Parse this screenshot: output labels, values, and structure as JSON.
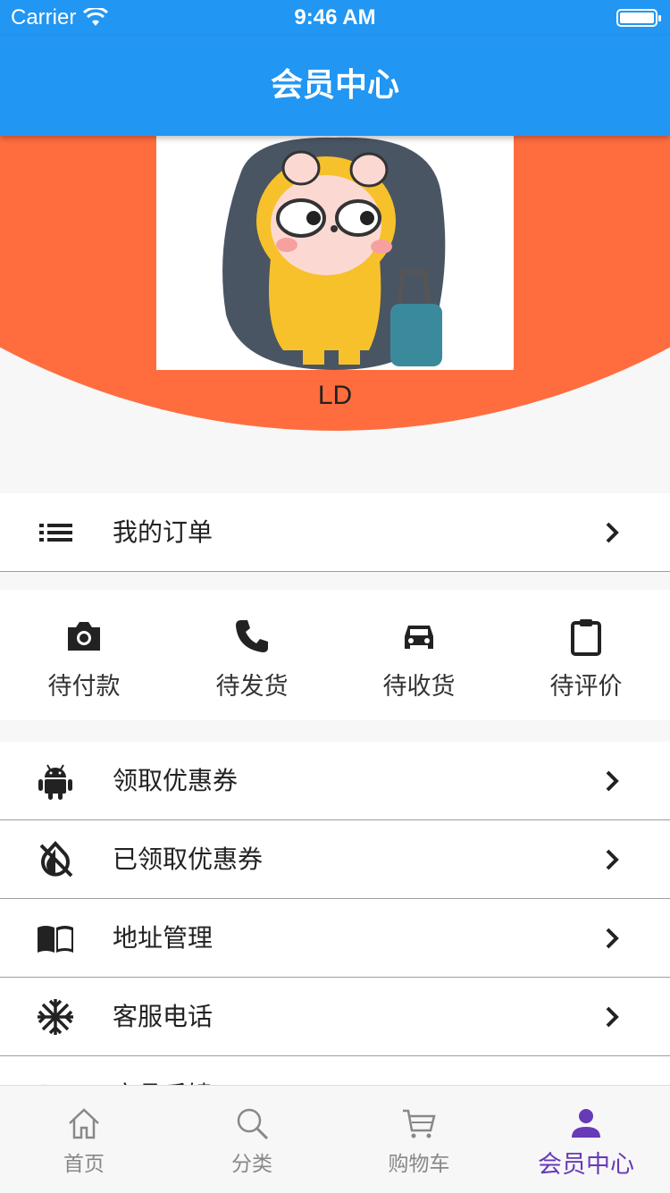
{
  "status_bar": {
    "carrier": "Carrier",
    "time": "9:46 AM"
  },
  "app_bar": {
    "title": "会员中心"
  },
  "profile": {
    "username": "LD"
  },
  "my_orders": {
    "label": "我的订单"
  },
  "order_status": [
    {
      "label": "待付款",
      "icon": "camera-icon"
    },
    {
      "label": "待发货",
      "icon": "phone-icon"
    },
    {
      "label": "待收货",
      "icon": "car-icon"
    },
    {
      "label": "待评价",
      "icon": "clipboard-icon"
    }
  ],
  "menu": [
    {
      "label": "领取优惠券",
      "icon": "android-icon"
    },
    {
      "label": "已领取优惠券",
      "icon": "invert-colors-off-icon"
    },
    {
      "label": "地址管理",
      "icon": "book-icon"
    },
    {
      "label": "客服电话",
      "icon": "snowflake-icon"
    },
    {
      "label": "商品反馈",
      "icon": "wifi-icon"
    }
  ],
  "tab_bar": {
    "active_color": "#673ab7",
    "items": [
      {
        "label": "首页",
        "icon": "home-icon"
      },
      {
        "label": "分类",
        "icon": "search-icon"
      },
      {
        "label": "购物车",
        "icon": "cart-icon"
      },
      {
        "label": "会员中心",
        "icon": "person-icon"
      }
    ]
  },
  "colors": {
    "primary": "#2196f3",
    "hero": "#ff6d3f",
    "accent": "#673ab7"
  }
}
